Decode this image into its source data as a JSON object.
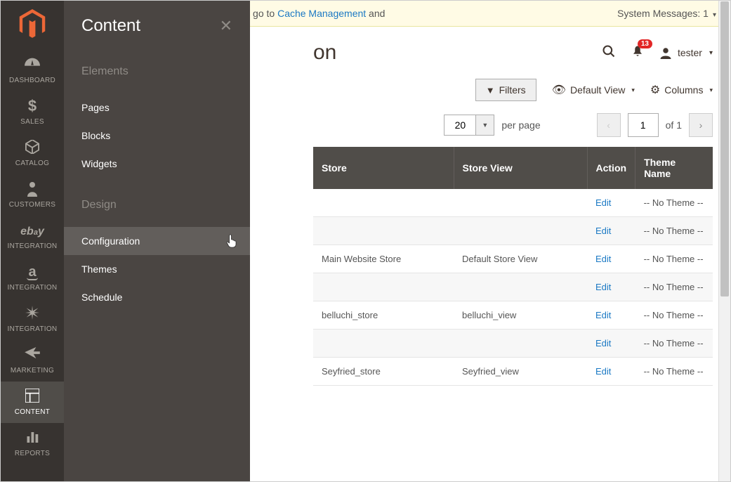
{
  "flyout": {
    "title": "Content",
    "sections": [
      {
        "title": "Elements",
        "items": [
          "Pages",
          "Blocks",
          "Widgets"
        ]
      },
      {
        "title": "Design",
        "items": [
          "Configuration",
          "Themes",
          "Schedule"
        ],
        "highlighted_index": 0
      }
    ]
  },
  "sidebar": {
    "items": [
      {
        "label": "DASHBOARD"
      },
      {
        "label": "SALES"
      },
      {
        "label": "CATALOG"
      },
      {
        "label": "CUSTOMERS"
      },
      {
        "label": "INTEGRATION"
      },
      {
        "label": "INTEGRATION"
      },
      {
        "label": "INTEGRATION"
      },
      {
        "label": "MARKETING"
      },
      {
        "label": "CONTENT"
      },
      {
        "label": "REPORTS"
      }
    ],
    "active_index": 8
  },
  "system_message": {
    "text_before": "es are invalidated: Page Cache. Please go to ",
    "link_text": "Cache Management",
    "text_after": " and",
    "right": "System Messages: 1"
  },
  "header": {
    "page_title_visible": "on",
    "notif_count": "13",
    "username": "tester"
  },
  "controls": {
    "filters": "Filters",
    "default_view": "Default View",
    "columns": "Columns"
  },
  "pagination": {
    "page_size": "20",
    "per_page_label": "per page",
    "current_page": "1",
    "of_label": "of 1"
  },
  "table": {
    "headers": {
      "store": "Store",
      "store_view": "Store View",
      "action": "Action",
      "theme": "Theme Name"
    },
    "rows": [
      {
        "store": "",
        "store_view": "",
        "action": "Edit",
        "theme": "-- No Theme --"
      },
      {
        "store": "",
        "store_view": "",
        "action": "Edit",
        "theme": "-- No Theme --"
      },
      {
        "store": "Main Website Store",
        "store_view": "Default Store View",
        "action": "Edit",
        "theme": "-- No Theme --"
      },
      {
        "store": "",
        "store_view": "",
        "action": "Edit",
        "theme": "-- No Theme --"
      },
      {
        "store": "belluchi_store",
        "store_view": "belluchi_view",
        "action": "Edit",
        "theme": "-- No Theme --"
      },
      {
        "store": "",
        "store_view": "",
        "action": "Edit",
        "theme": "-- No Theme --"
      },
      {
        "store": "Seyfried_store",
        "store_view": "Seyfried_view",
        "action": "Edit",
        "theme": "-- No Theme --"
      }
    ]
  }
}
